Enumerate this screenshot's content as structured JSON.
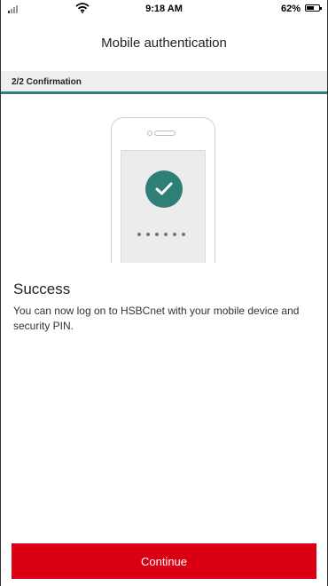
{
  "status_bar": {
    "time": "9:18 AM",
    "battery_percent": "62%"
  },
  "header": {
    "title": "Mobile authentication"
  },
  "step": {
    "label": "2/2 Confirmation"
  },
  "content": {
    "title": "Success",
    "message": "You can now log on to HSBCnet with your mobile device and security PIN."
  },
  "actions": {
    "continue_label": "Continue"
  },
  "icons": {
    "illustration": "phone-with-checkmark-icon",
    "success": "checkmark-icon"
  },
  "colors": {
    "brand_red": "#db0011",
    "accent_teal": "#2e8077",
    "step_bar_bg": "#efefef"
  }
}
